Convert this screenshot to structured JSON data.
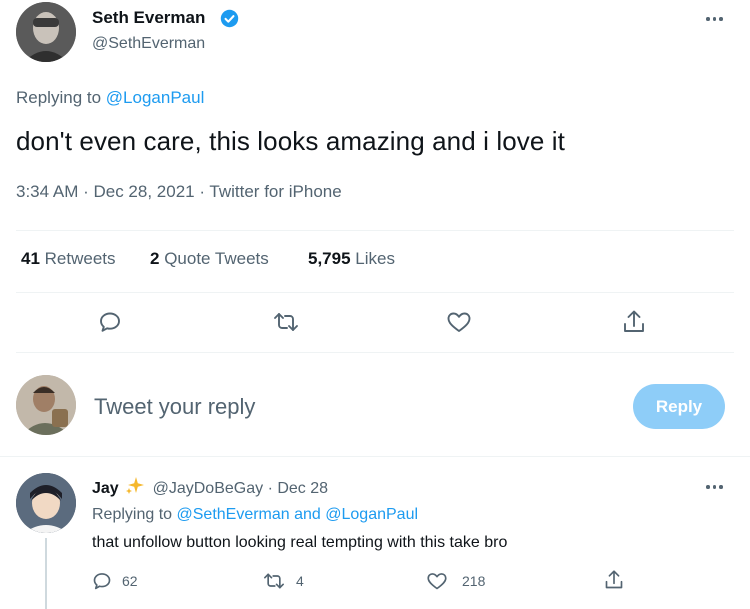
{
  "tweet": {
    "author_name": "Seth Everman",
    "author_handle": "@SethEverman",
    "replying_prefix": "Replying to",
    "replying_to": "@LoganPaul",
    "text": "don't even care, this looks amazing and i love it",
    "timestamp": "3:34 AM · Dec 28, 2021 · Twitter for iPhone",
    "stats": {
      "retweets_count": "41",
      "retweets_label": "Retweets",
      "quotes_count": "2",
      "quotes_label": "Quote Tweets",
      "likes_count": "5,795",
      "likes_label": "Likes"
    }
  },
  "composer": {
    "placeholder": "Tweet your reply",
    "reply_button": "Reply"
  },
  "reply_tweet": {
    "author_name": "Jay",
    "author_handle": "@JayDoBeGay",
    "date": "· Dec 28",
    "replying_prefix": "Replying to",
    "replying_to": "@SethEverman and @LoganPaul",
    "text": "that unfollow button looking real tempting with this take bro",
    "reply_count": "62",
    "retweet_count": "4",
    "like_count": "218"
  },
  "icons": {
    "verified": "verified-badge-icon",
    "reply": "reply-icon",
    "retweet": "retweet-icon",
    "like": "heart-icon",
    "share": "share-icon",
    "more": "more-icon",
    "sparkle": "sparkle-icon"
  },
  "colors": {
    "accent": "#1d9bf0",
    "reply_button_disabled": "#8ecdf8",
    "muted_text": "#536471",
    "divider": "#eff3f4"
  }
}
